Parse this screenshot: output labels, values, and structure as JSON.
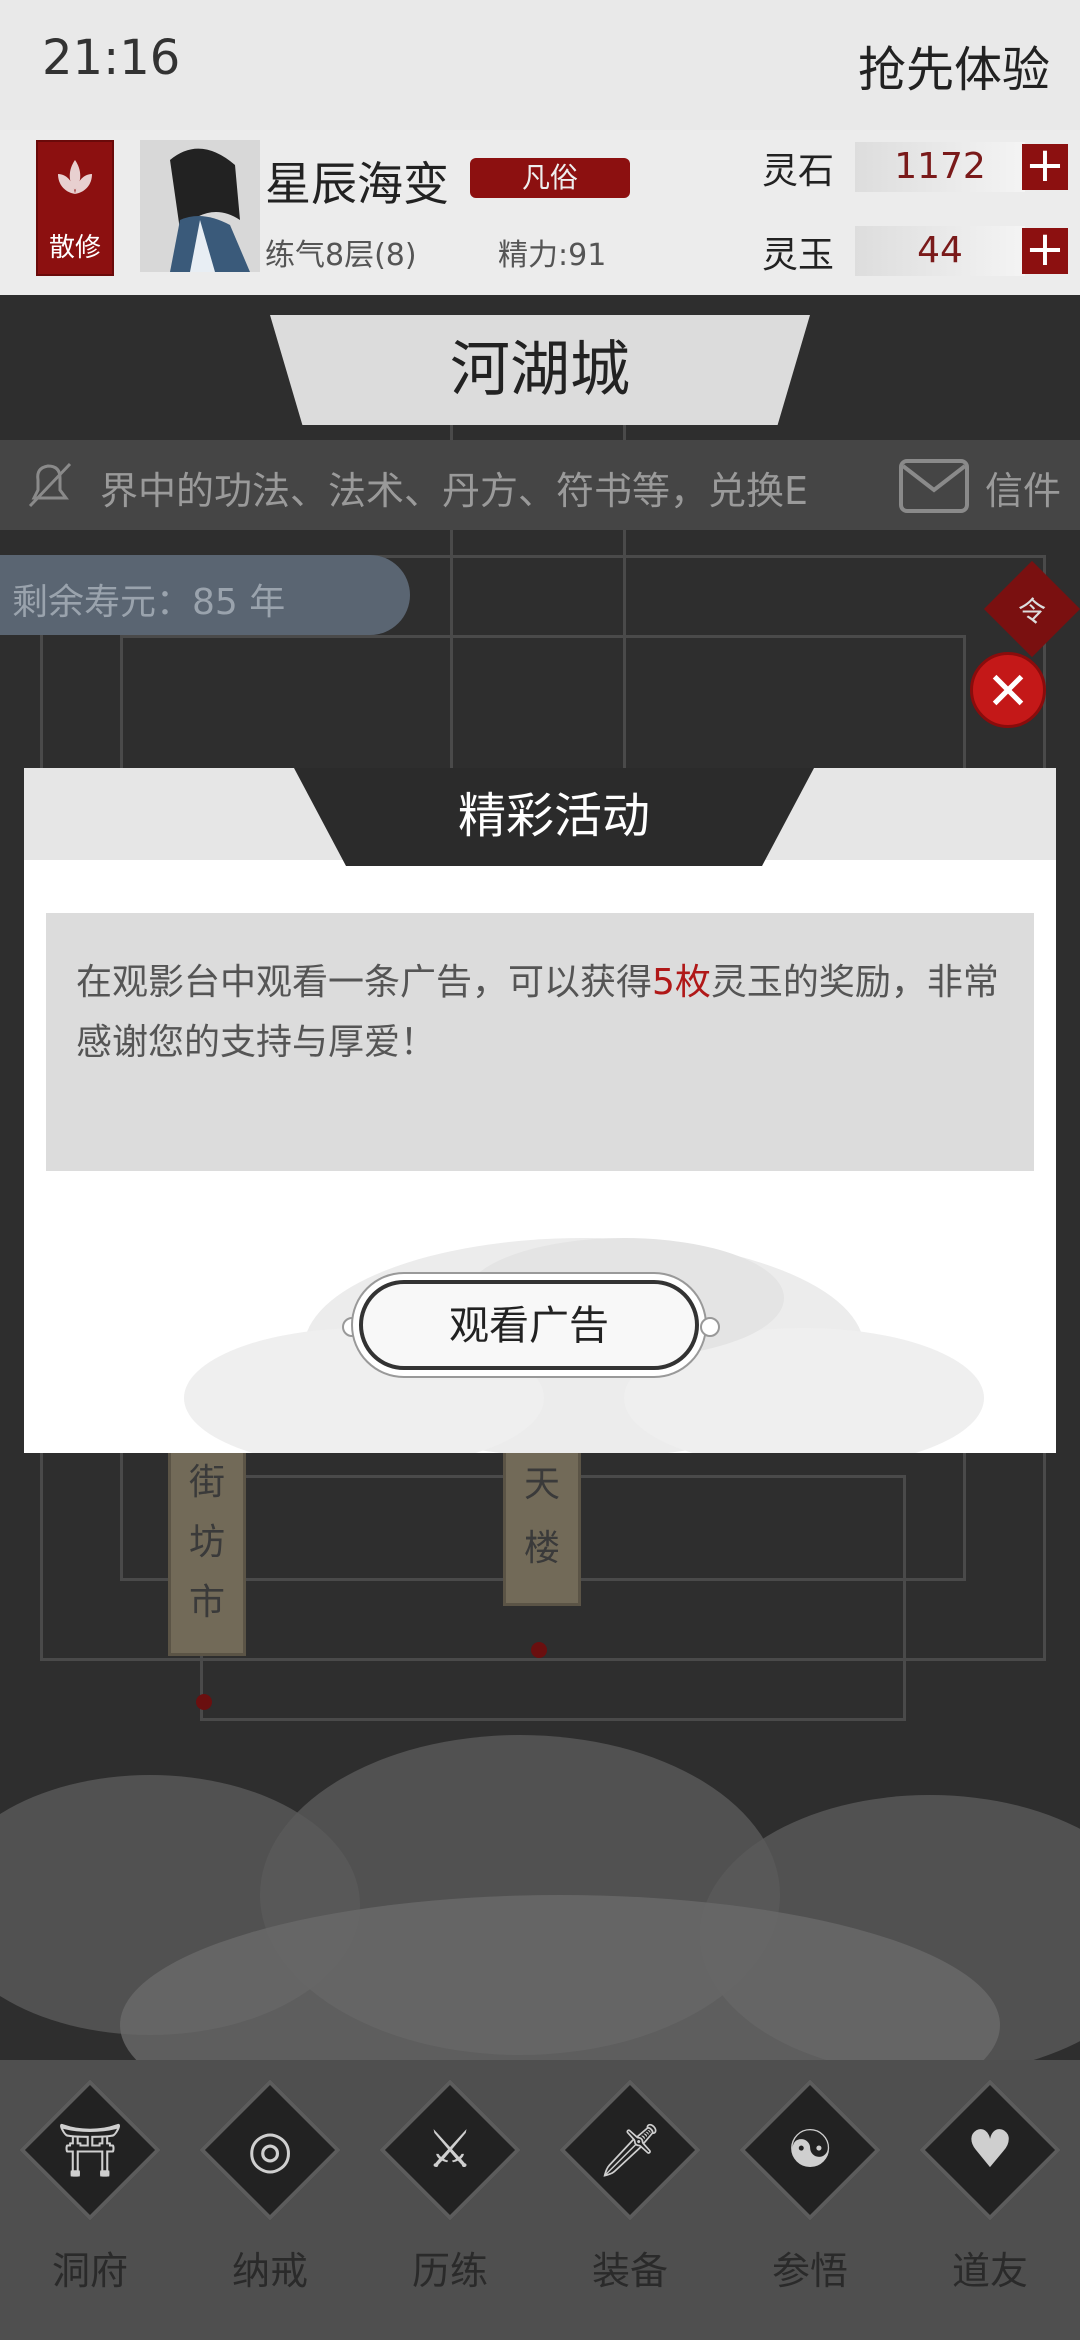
{
  "status": {
    "time": "21:16",
    "title": "抢先体验"
  },
  "player": {
    "sect_label": "散修",
    "name": "星辰海变",
    "rank": "凡俗",
    "level": "练气8层(8)",
    "energy": "精力:91"
  },
  "currency": {
    "stone_label": "灵石",
    "stone_value": "1172",
    "jade_label": "灵玉",
    "jade_value": "44"
  },
  "city": {
    "name": "河湖城"
  },
  "notice": {
    "text": "界中的功法、法术、丹方、符书等，兑换E",
    "mail_label": "信件"
  },
  "lifespan": {
    "text": "剩余寿元：85 年"
  },
  "side": {
    "order_glyph": "令",
    "close_glyph": "✕"
  },
  "locations": {
    "market": "街坊市",
    "tower": "天楼"
  },
  "modal": {
    "title": "精彩活动",
    "message_prefix": "在观影台中观看一条广告，可以获得",
    "message_highlight": "5枚",
    "message_suffix": "灵玉的奖励，非常感谢您的支持与厚爱！",
    "button_label": "观看广告"
  },
  "nav": [
    {
      "label": "洞府",
      "icon": "gate-icon"
    },
    {
      "label": "纳戒",
      "icon": "ring-icon"
    },
    {
      "label": "历练",
      "icon": "crossed-swords-icon"
    },
    {
      "label": "装备",
      "icon": "dagger-icon"
    },
    {
      "label": "参悟",
      "icon": "book-icon"
    },
    {
      "label": "道友",
      "icon": "handshake-icon"
    }
  ],
  "colors": {
    "accent_red": "#8c1010",
    "highlight_red": "#b01818",
    "map_dark": "#2e2e2e"
  }
}
